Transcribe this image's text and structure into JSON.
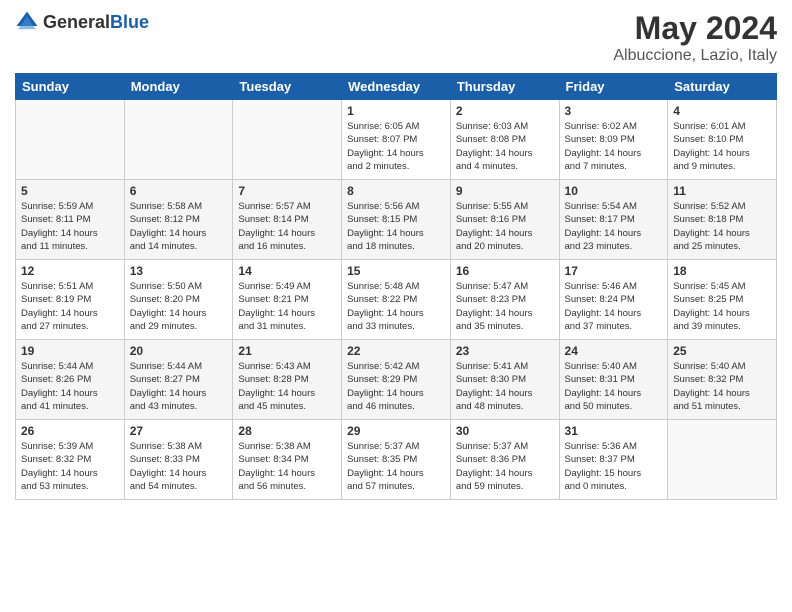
{
  "logo": {
    "general": "General",
    "blue": "Blue"
  },
  "header": {
    "month": "May 2024",
    "location": "Albuccione, Lazio, Italy"
  },
  "weekdays": [
    "Sunday",
    "Monday",
    "Tuesday",
    "Wednesday",
    "Thursday",
    "Friday",
    "Saturday"
  ],
  "weeks": [
    [
      {
        "day": "",
        "info": ""
      },
      {
        "day": "",
        "info": ""
      },
      {
        "day": "",
        "info": ""
      },
      {
        "day": "1",
        "info": "Sunrise: 6:05 AM\nSunset: 8:07 PM\nDaylight: 14 hours\nand 2 minutes."
      },
      {
        "day": "2",
        "info": "Sunrise: 6:03 AM\nSunset: 8:08 PM\nDaylight: 14 hours\nand 4 minutes."
      },
      {
        "day": "3",
        "info": "Sunrise: 6:02 AM\nSunset: 8:09 PM\nDaylight: 14 hours\nand 7 minutes."
      },
      {
        "day": "4",
        "info": "Sunrise: 6:01 AM\nSunset: 8:10 PM\nDaylight: 14 hours\nand 9 minutes."
      }
    ],
    [
      {
        "day": "5",
        "info": "Sunrise: 5:59 AM\nSunset: 8:11 PM\nDaylight: 14 hours\nand 11 minutes."
      },
      {
        "day": "6",
        "info": "Sunrise: 5:58 AM\nSunset: 8:12 PM\nDaylight: 14 hours\nand 14 minutes."
      },
      {
        "day": "7",
        "info": "Sunrise: 5:57 AM\nSunset: 8:14 PM\nDaylight: 14 hours\nand 16 minutes."
      },
      {
        "day": "8",
        "info": "Sunrise: 5:56 AM\nSunset: 8:15 PM\nDaylight: 14 hours\nand 18 minutes."
      },
      {
        "day": "9",
        "info": "Sunrise: 5:55 AM\nSunset: 8:16 PM\nDaylight: 14 hours\nand 20 minutes."
      },
      {
        "day": "10",
        "info": "Sunrise: 5:54 AM\nSunset: 8:17 PM\nDaylight: 14 hours\nand 23 minutes."
      },
      {
        "day": "11",
        "info": "Sunrise: 5:52 AM\nSunset: 8:18 PM\nDaylight: 14 hours\nand 25 minutes."
      }
    ],
    [
      {
        "day": "12",
        "info": "Sunrise: 5:51 AM\nSunset: 8:19 PM\nDaylight: 14 hours\nand 27 minutes."
      },
      {
        "day": "13",
        "info": "Sunrise: 5:50 AM\nSunset: 8:20 PM\nDaylight: 14 hours\nand 29 minutes."
      },
      {
        "day": "14",
        "info": "Sunrise: 5:49 AM\nSunset: 8:21 PM\nDaylight: 14 hours\nand 31 minutes."
      },
      {
        "day": "15",
        "info": "Sunrise: 5:48 AM\nSunset: 8:22 PM\nDaylight: 14 hours\nand 33 minutes."
      },
      {
        "day": "16",
        "info": "Sunrise: 5:47 AM\nSunset: 8:23 PM\nDaylight: 14 hours\nand 35 minutes."
      },
      {
        "day": "17",
        "info": "Sunrise: 5:46 AM\nSunset: 8:24 PM\nDaylight: 14 hours\nand 37 minutes."
      },
      {
        "day": "18",
        "info": "Sunrise: 5:45 AM\nSunset: 8:25 PM\nDaylight: 14 hours\nand 39 minutes."
      }
    ],
    [
      {
        "day": "19",
        "info": "Sunrise: 5:44 AM\nSunset: 8:26 PM\nDaylight: 14 hours\nand 41 minutes."
      },
      {
        "day": "20",
        "info": "Sunrise: 5:44 AM\nSunset: 8:27 PM\nDaylight: 14 hours\nand 43 minutes."
      },
      {
        "day": "21",
        "info": "Sunrise: 5:43 AM\nSunset: 8:28 PM\nDaylight: 14 hours\nand 45 minutes."
      },
      {
        "day": "22",
        "info": "Sunrise: 5:42 AM\nSunset: 8:29 PM\nDaylight: 14 hours\nand 46 minutes."
      },
      {
        "day": "23",
        "info": "Sunrise: 5:41 AM\nSunset: 8:30 PM\nDaylight: 14 hours\nand 48 minutes."
      },
      {
        "day": "24",
        "info": "Sunrise: 5:40 AM\nSunset: 8:31 PM\nDaylight: 14 hours\nand 50 minutes."
      },
      {
        "day": "25",
        "info": "Sunrise: 5:40 AM\nSunset: 8:32 PM\nDaylight: 14 hours\nand 51 minutes."
      }
    ],
    [
      {
        "day": "26",
        "info": "Sunrise: 5:39 AM\nSunset: 8:32 PM\nDaylight: 14 hours\nand 53 minutes."
      },
      {
        "day": "27",
        "info": "Sunrise: 5:38 AM\nSunset: 8:33 PM\nDaylight: 14 hours\nand 54 minutes."
      },
      {
        "day": "28",
        "info": "Sunrise: 5:38 AM\nSunset: 8:34 PM\nDaylight: 14 hours\nand 56 minutes."
      },
      {
        "day": "29",
        "info": "Sunrise: 5:37 AM\nSunset: 8:35 PM\nDaylight: 14 hours\nand 57 minutes."
      },
      {
        "day": "30",
        "info": "Sunrise: 5:37 AM\nSunset: 8:36 PM\nDaylight: 14 hours\nand 59 minutes."
      },
      {
        "day": "31",
        "info": "Sunrise: 5:36 AM\nSunset: 8:37 PM\nDaylight: 15 hours\nand 0 minutes."
      },
      {
        "day": "",
        "info": ""
      }
    ]
  ]
}
